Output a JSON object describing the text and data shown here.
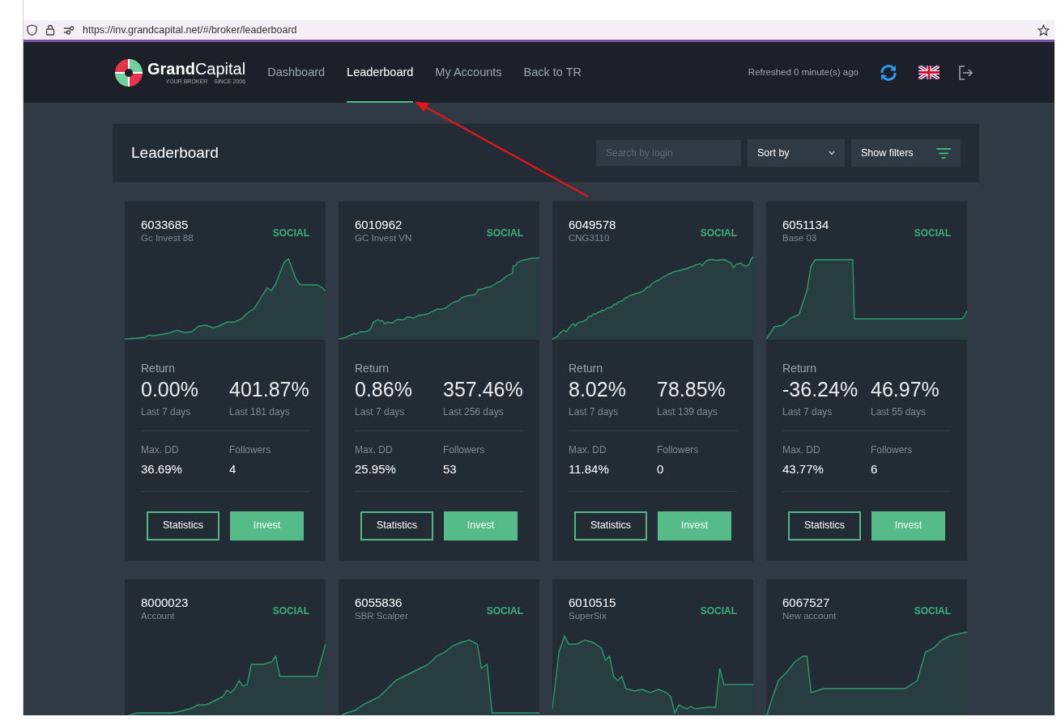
{
  "browser": {
    "url": "https://inv.grandcapital.net/#/broker/leaderboard"
  },
  "navbar": {
    "logo": {
      "brand_bold": "Grand",
      "brand_light": "Capital",
      "tagline_left": "YOUR BROKER",
      "tagline_right": "SINCE 2006"
    },
    "links": [
      {
        "label": "Dashboard",
        "selected": false
      },
      {
        "label": "Leaderboard",
        "selected": true
      },
      {
        "label": "My Accounts",
        "selected": false
      },
      {
        "label": "Back to TR",
        "selected": false
      }
    ],
    "refreshed": "Refreshed 0 minute(s) ago"
  },
  "header": {
    "title": "Leaderboard",
    "search": {
      "placeholder": "Search by login"
    },
    "sort": {
      "label": "Sort by"
    },
    "filters": {
      "label": "Show filters"
    }
  },
  "cards": [
    {
      "login": "6033685",
      "name": "Gc Invest 88",
      "type": "SOCIAL",
      "return_label": "Return",
      "week_return": "0.00%",
      "week_label": "Last 7 days",
      "total_return": "401.87%",
      "total_label": "Last 181 days",
      "maxdd_label": "Max. DD",
      "maxdd": "36.69%",
      "followers_label": "Followers",
      "followers": "4",
      "buttons": [
        "Statistics",
        "Invest"
      ]
    },
    {
      "login": "6010962",
      "name": "GC Invest VN",
      "type": "SOCIAL",
      "return_label": "Return",
      "week_return": "0.86%",
      "week_label": "Last 7 days",
      "total_return": "357.46%",
      "total_label": "Last 256 days",
      "maxdd_label": "Max. DD",
      "maxdd": "25.95%",
      "followers_label": "Followers",
      "followers": "53",
      "buttons": [
        "Statistics",
        "Invest"
      ]
    },
    {
      "login": "6049578",
      "name": "CNG3110",
      "type": "SOCIAL",
      "return_label": "Return",
      "week_return": "8.02%",
      "week_label": "Last 7 days",
      "total_return": "78.85%",
      "total_label": "Last 139 days",
      "maxdd_label": "Max. DD",
      "maxdd": "11.84%",
      "followers_label": "Followers",
      "followers": "0",
      "buttons": [
        "Statistics",
        "Invest"
      ]
    },
    {
      "login": "6051134",
      "name": "Base 03",
      "type": "SOCIAL",
      "return_label": "Return",
      "week_return": "-36.24%",
      "week_label": "Last 7 days",
      "total_return": "46.97%",
      "total_label": "Last 55 days",
      "maxdd_label": "Max. DD",
      "maxdd": "43.77%",
      "followers_label": "Followers",
      "followers": "6",
      "buttons": [
        "Statistics",
        "Invest"
      ]
    },
    {
      "login": "8000023",
      "name": "Account",
      "type": "SOCIAL"
    },
    {
      "login": "6055836",
      "name": "SBR Scalper",
      "type": "SOCIAL"
    },
    {
      "login": "6010515",
      "name": "SuperSix",
      "type": "SOCIAL"
    },
    {
      "login": "6067527",
      "name": "New account",
      "type": "SOCIAL"
    }
  ]
}
